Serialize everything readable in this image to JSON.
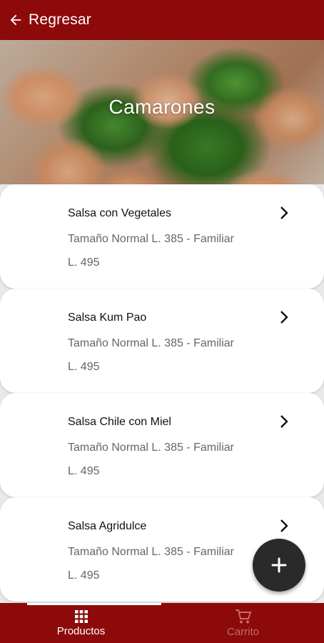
{
  "appbar": {
    "title": "Regresar",
    "back_icon": "arrow-left-icon"
  },
  "hero": {
    "title": "Camarones"
  },
  "products": [
    {
      "name": "Salsa con Vegetales",
      "desc": "  Tamaño Normal L. 385 - Familiar L. 495"
    },
    {
      "name": "Salsa Kum Pao",
      "desc": "  Tamaño Normal L. 385 - Familiar L. 495"
    },
    {
      "name": "Salsa Chile con Miel",
      "desc": "  Tamaño Normal L. 385 - Familiar L. 495"
    },
    {
      "name": "Salsa Agridulce",
      "desc": "  Tamaño Normal L. 385 - Familiar L. 495"
    }
  ],
  "fab": {
    "icon": "plus-icon"
  },
  "bottom_nav": {
    "items": [
      {
        "label": "Productos",
        "icon": "grid-icon",
        "active": true
      },
      {
        "label": "Carrito",
        "icon": "cart-icon",
        "active": false
      }
    ]
  },
  "colors": {
    "brand": "#8d0a0a",
    "fab": "#2a2a2a",
    "inactive": "#c46a6a"
  }
}
